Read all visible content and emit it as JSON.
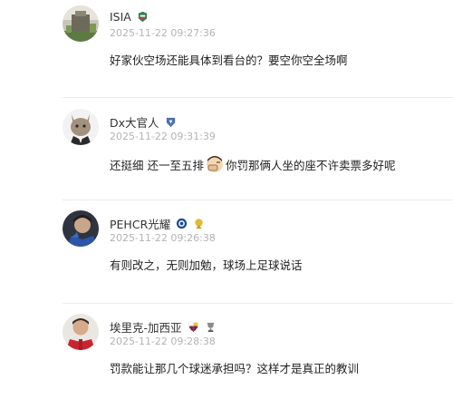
{
  "comments": [
    {
      "username": "ISIA",
      "badges": [
        "team-crest-icon"
      ],
      "timestamp": "2025-11-22 09:27:36",
      "text": "好家伙空场还能具体到看台的？要空你空全场啊"
    },
    {
      "username": "Dx大官人",
      "badges": [
        "shield-badge-icon"
      ],
      "timestamp": "2025-11-22 09:31:39",
      "text_before": "还挺细 还一至五排",
      "inline_emoji": "facepalm-emoji",
      "text_after": "你罚那俩人坐的座不许卖票多好呢"
    },
    {
      "username": "PEHCR光耀",
      "badges": [
        "chelsea-crest-icon",
        "trophy-badge-icon"
      ],
      "timestamp": "2025-11-22 09:26:38",
      "text": "有则改之，无则加勉，球场上足球说话"
    },
    {
      "username": "埃里克-加西亚",
      "badges": [
        "barcelona-crest-icon",
        "trophy-icon"
      ],
      "timestamp": "2025-11-22 09:28:38",
      "text": "罚款能让那几个球迷承担吗？这样才是真正的教训"
    }
  ],
  "colors": {
    "username": "#333333",
    "timestamp": "#b3b3b3",
    "text": "#222222",
    "divider": "#ececec"
  }
}
